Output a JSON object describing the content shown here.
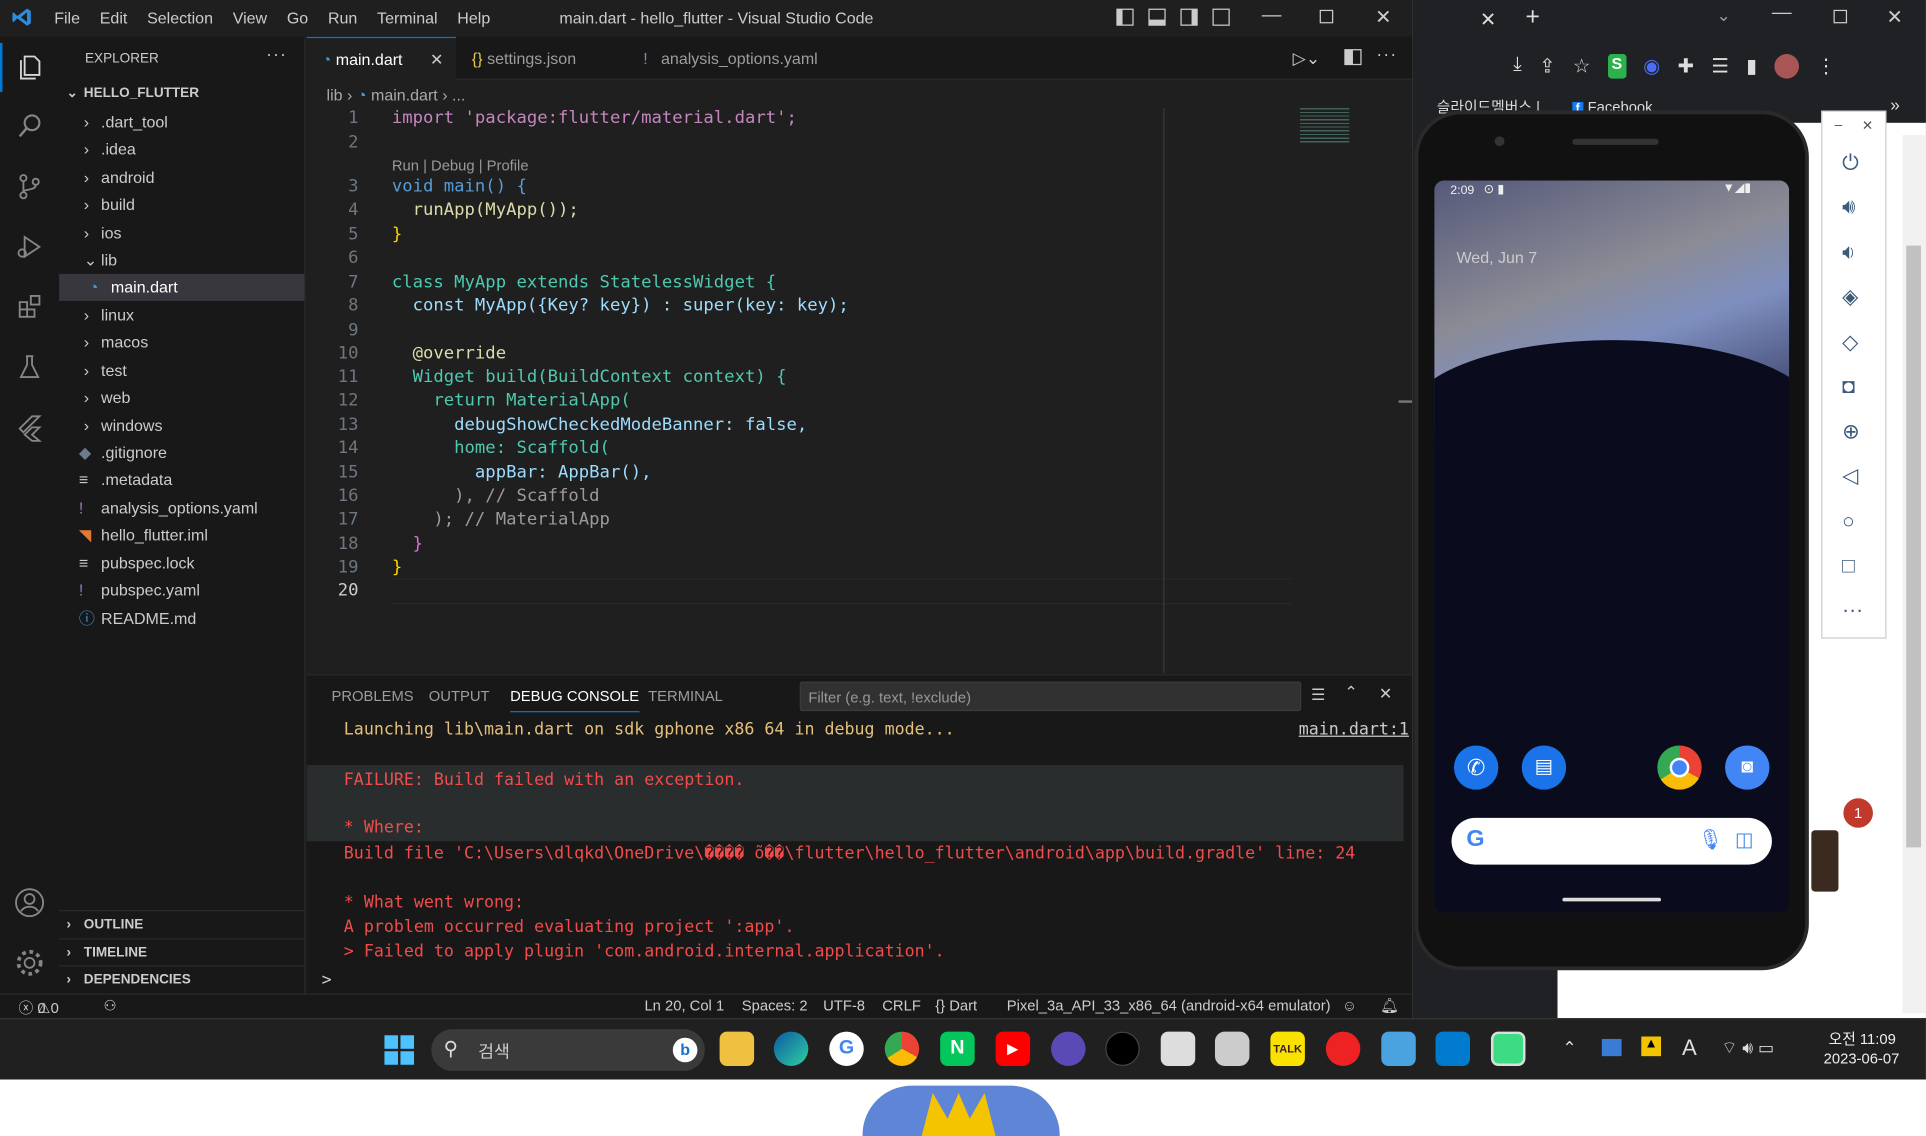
{
  "vscode": {
    "menu": [
      "File",
      "Edit",
      "Selection",
      "View",
      "Go",
      "Run",
      "Terminal",
      "Help"
    ],
    "title": "main.dart - hello_flutter - Visual Studio Code",
    "explorer": {
      "header": "EXPLORER",
      "project": "HELLO_FLUTTER",
      "items": [
        ".dart_tool",
        ".idea",
        "android",
        "build",
        "ios",
        "lib",
        "main.dart",
        "linux",
        "macos",
        "test",
        "web",
        "windows",
        ".gitignore",
        ".metadata",
        "analysis_options.yaml",
        "hello_flutter.iml",
        "pubspec.lock",
        "pubspec.yaml",
        "README.md"
      ],
      "sections": [
        "OUTLINE",
        "TIMELINE",
        "DEPENDENCIES"
      ]
    },
    "tabs": [
      "main.dart",
      "settings.json",
      "analysis_options.yaml"
    ],
    "breadcrumb": [
      "lib",
      "main.dart",
      "..."
    ],
    "codelens": "Run | Debug | Profile",
    "code": [
      "import 'package:flutter/material.dart';",
      "",
      "void main() {",
      "  runApp(MyApp());",
      "}",
      "",
      "class MyApp extends StatelessWidget {",
      "  const MyApp({Key? key}) : super(key: key);",
      "",
      "  @override",
      "  Widget build(BuildContext context) {",
      "    return MaterialApp(",
      "      debugShowCheckedModeBanner: false,",
      "      home: Scaffold(",
      "        appBar: AppBar(),",
      "      ), // Scaffold",
      "    ); // MaterialApp",
      "  }",
      "}",
      ""
    ],
    "line_numbers": [
      "1",
      "2",
      "3",
      "4",
      "5",
      "6",
      "7",
      "8",
      "9",
      "10",
      "11",
      "12",
      "13",
      "14",
      "15",
      "16",
      "17",
      "18",
      "19",
      "20"
    ],
    "panel": {
      "tabs": [
        "PROBLEMS",
        "OUTPUT",
        "DEBUG CONSOLE",
        "TERMINAL"
      ],
      "filter_placeholder": "Filter (e.g. text, !exclude)",
      "launch": "Launching lib\\main.dart on sdk gphone x86 64 in debug mode...",
      "link": "main.dart:1",
      "lines": [
        "FAILURE: Build failed with an exception.",
        "",
        "* Where:",
        "Build file 'C:\\Users\\dlqkd\\OneDrive\\���� õ��\\flutter\\hello_flutter\\android\\app\\build.gradle' line: 24",
        "",
        "* What went wrong:",
        "A problem occurred evaluating project ':app'.",
        "> Failed to apply plugin 'com.android.internal.application'."
      ],
      "prompt": ">"
    },
    "status": {
      "errors": "0",
      "warnings": "0",
      "position": "Ln 20, Col 1",
      "spaces": "Spaces: 2",
      "encoding": "UTF-8",
      "eol": "CRLF",
      "lang": "{} Dart",
      "device": "Pixel_3a_API_33_x86_64 (android-x64 emulator)"
    }
  },
  "chrome": {
    "bookmarks": [
      "슬라이드멤버스 |",
      "Facebook"
    ],
    "more": "»"
  },
  "phone": {
    "time": "2:09",
    "date": "Wed, Jun 7"
  },
  "taskbar": {
    "search": "검색",
    "time": "오전 11:09",
    "date": "2023-06-07",
    "badge": "1"
  }
}
